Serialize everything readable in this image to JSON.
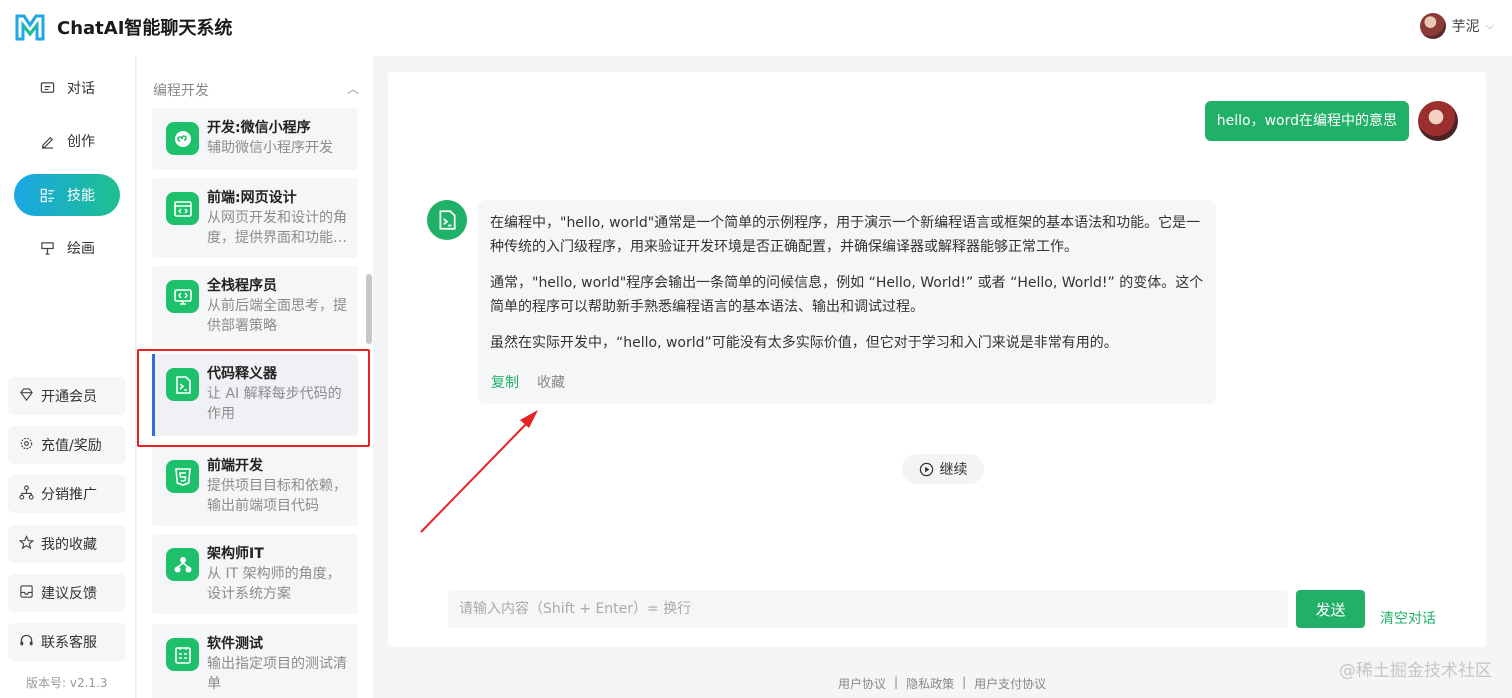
{
  "header": {
    "app_title": "ChatAI智能聊天系统",
    "user_name": "芋泥"
  },
  "nav": {
    "items": [
      {
        "label": "对话",
        "icon": "chat-icon"
      },
      {
        "label": "创作",
        "icon": "edit-icon"
      },
      {
        "label": "技能",
        "icon": "skills-icon",
        "active": true
      },
      {
        "label": "绘画",
        "icon": "paint-icon"
      }
    ],
    "buttons": [
      {
        "label": "开通会员",
        "icon": "diamond-icon"
      },
      {
        "label": "充值/奖励",
        "icon": "gear-icon"
      },
      {
        "label": "分销推广",
        "icon": "share-icon"
      },
      {
        "label": "我的收藏",
        "icon": "star-icon"
      },
      {
        "label": "建议反馈",
        "icon": "feedback-icon"
      },
      {
        "label": "联系客服",
        "icon": "headset-icon"
      }
    ],
    "version": "版本号: v2.1.3"
  },
  "skills": {
    "category": "编程开发",
    "items": [
      {
        "title": "开发:微信小程序",
        "desc": "辅助微信小程序开发"
      },
      {
        "title": "前端:网页设计",
        "desc": "从网页开发和设计的角度，提供界面和功能…"
      },
      {
        "title": "全栈程序员",
        "desc": "从前后端全面思考，提供部署策略"
      },
      {
        "title": "代码释义器",
        "desc": "让 AI 解释每步代码的作用"
      },
      {
        "title": "前端开发",
        "desc": "提供项目目标和依赖，输出前端项目代码"
      },
      {
        "title": "架构师IT",
        "desc": "从 IT 架构师的角度，设计系统方案"
      },
      {
        "title": "软件测试",
        "desc": "输出指定项目的测试清单"
      }
    ]
  },
  "chat": {
    "user_message": "hello，word在编程中的意思",
    "bot_paragraphs": [
      "在编程中，\"hello, world\"通常是一个简单的示例程序，用于演示一个新编程语言或框架的基本语法和功能。它是一种传统的入门级程序，用来验证开发环境是否正确配置，并确保编译器或解释器能够正常工作。",
      "通常，\"hello, world\"程序会输出一条简单的问候信息，例如 “Hello, World!” 或者 “Hello, World!” 的变体。这个简单的程序可以帮助新手熟悉编程语言的基本语法、输出和调试过程。",
      "虽然在实际开发中，“hello, world”可能没有太多实际价值，但它对于学习和入门来说是非常有用的。"
    ],
    "copy_label": "复制",
    "fav_label": "收藏",
    "continue_label": "继续",
    "input_placeholder": "请输入内容（Shift + Enter）= 换行",
    "send_label": "发送",
    "clear_label": "清空对话"
  },
  "footer": {
    "links": [
      "用户协议",
      "隐私政策",
      "用户支付协议"
    ],
    "separator": "|"
  },
  "watermark": "@稀土掘金技术社区",
  "colors": {
    "accent": "#21b067",
    "annotation": "#e62222"
  }
}
